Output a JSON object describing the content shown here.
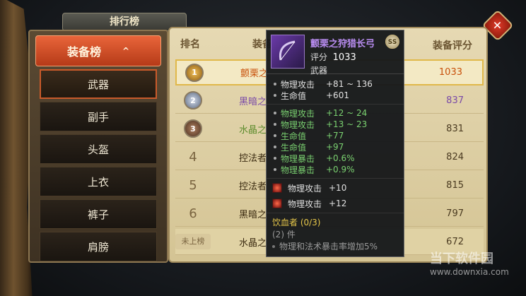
{
  "title": "排行榜",
  "close_icon": "close-icon",
  "nav": {
    "header": "装备榜",
    "header_chevron": "^",
    "items": [
      "武器",
      "副手",
      "头盔",
      "上衣",
      "裤子",
      "肩膀"
    ],
    "selected_index": 0
  },
  "table": {
    "col_rank": "排名",
    "col_equip": "装备名",
    "col_score": "装备评分",
    "rows": [
      {
        "rank": "1",
        "name": "颤栗之",
        "score": "1033",
        "color": "#c8500a"
      },
      {
        "rank": "2",
        "name": "黑暗之",
        "score": "837",
        "color": "#7a4aa8"
      },
      {
        "rank": "3",
        "name": "水晶之",
        "score": "831",
        "color": "#5a8a2a"
      },
      {
        "rank": "4",
        "name": "控法者",
        "score": "824",
        "color": "#3a2a10"
      },
      {
        "rank": "5",
        "name": "控法者",
        "score": "815",
        "color": "#3a2a10"
      },
      {
        "rank": "6",
        "name": "黑暗之",
        "score": "797",
        "color": "#3a2a10"
      },
      {
        "rank": "未上榜",
        "name": "水晶之",
        "score": "672",
        "color": "#3a2a10"
      }
    ]
  },
  "tooltip": {
    "item_name": "颤栗之狩猎长弓",
    "grade_badge": "SS",
    "score_label": "评分",
    "score_value": "1033",
    "type_label": "武器",
    "base_stats": [
      {
        "label": "物理攻击",
        "value": "+81 ~ 136"
      },
      {
        "label": "生命值",
        "value": "+601"
      }
    ],
    "extra_stats": [
      {
        "label": "物理攻击",
        "value": "+12 ~ 24"
      },
      {
        "label": "物理攻击",
        "value": "+13 ~ 23"
      },
      {
        "label": "生命值",
        "value": "+77"
      },
      {
        "label": "生命值",
        "value": "+97"
      },
      {
        "label": "物理暴击",
        "value": "+0.6%"
      },
      {
        "label": "物理暴击",
        "value": "+0.9%"
      }
    ],
    "gems": [
      {
        "label": "物理攻击",
        "value": "+10"
      },
      {
        "label": "物理攻击",
        "value": "+12"
      }
    ],
    "set_title": "饮血者 (0/3)",
    "set_count": "(2) 件",
    "set_desc": "物理和法术暴击率增加5%"
  },
  "watermark": {
    "line1": "当下软件园",
    "line2": "www.downxia.com"
  }
}
